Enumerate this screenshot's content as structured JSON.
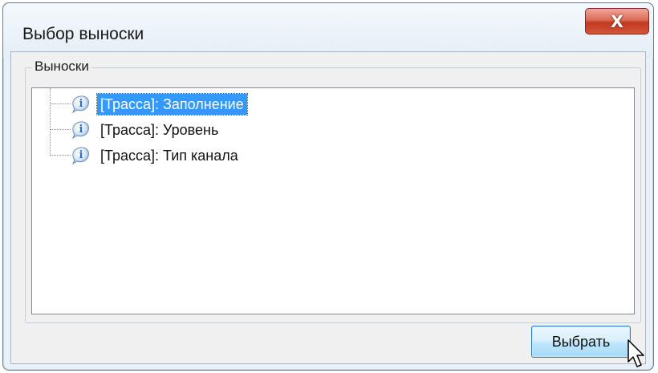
{
  "window": {
    "title": "Выбор выноски",
    "close_label": "X"
  },
  "groupbox": {
    "title": "Выноски"
  },
  "tree": {
    "items": [
      {
        "label": "[Трасса]: Заполнение",
        "icon": "info-icon",
        "selected": true
      },
      {
        "label": "[Трасса]: Уровень",
        "icon": "info-icon",
        "selected": false
      },
      {
        "label": "[Трасса]: Тип канала",
        "icon": "info-icon",
        "selected": false
      }
    ]
  },
  "buttons": {
    "select_label": "Выбрать"
  },
  "colors": {
    "selection": "#3399ff",
    "close_button": "#c1391f",
    "info_icon": "#3a78c8"
  }
}
